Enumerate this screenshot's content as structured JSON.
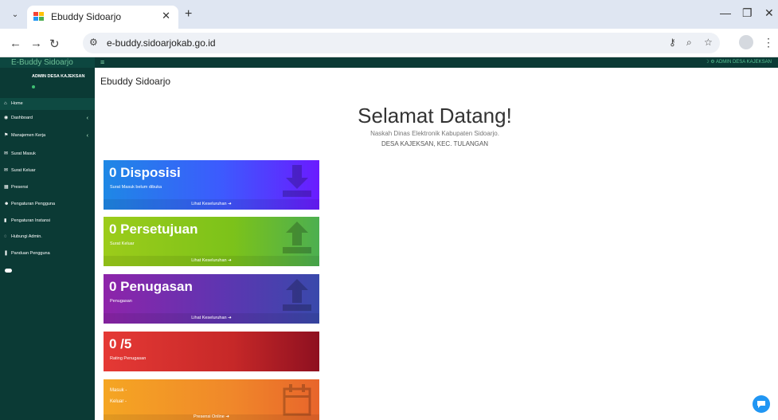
{
  "browser": {
    "tab_title": "Ebuddy Sidoarjo",
    "url": "e-buddy.sidoarjokab.go.id"
  },
  "app": {
    "brand": "E-Buddy Sidoarjo",
    "top_user": "ADMIN DESA KAJEKSAN",
    "sidebar": {
      "user_name": "ADMIN DESA KAJEKSAN",
      "items": [
        {
          "label": "Home",
          "icon": "home-icon"
        },
        {
          "label": "Dashboard",
          "icon": "dashboard-icon"
        },
        {
          "label": "Manajemen Kerja",
          "icon": "flag-icon"
        },
        {
          "label": "Surat Masuk",
          "icon": "envelope-icon"
        },
        {
          "label": "Surat Keluar",
          "icon": "envelope-icon"
        },
        {
          "label": "Presensi",
          "icon": "calendar-icon"
        },
        {
          "label": "Pengaturan Pengguna",
          "icon": "users-icon"
        },
        {
          "label": "Pengaturan Instansi",
          "icon": "building-icon"
        },
        {
          "label": "Hubungi Admin.",
          "icon": "whatsapp-icon"
        },
        {
          "label": "Panduan Pengguna",
          "icon": "book-icon"
        }
      ]
    },
    "page_title": "Ebuddy Sidoarjo",
    "welcome": {
      "title": "Selamat Datang!",
      "subtitle": "Naskah Dinas Elektronik Kabupaten Sidoarjo.",
      "location": "DESA KAJEKSAN, KEC. TULANGAN"
    },
    "cards": [
      {
        "title": "0 Disposisi",
        "sub": "Surat Masuk belum dibuka",
        "footer": "Lihat Keseluruhan"
      },
      {
        "title": "0 Persetujuan",
        "sub": "Surat Keluar",
        "footer": "Lihat Keseluruhan"
      },
      {
        "title": "0 Penugasan",
        "sub": "Penugasan",
        "footer": "Lihat Keseluruhan"
      },
      {
        "title": "0 /5",
        "sub": "Rating Penugasan"
      },
      {
        "line1": "Masuk  -",
        "line2": "Keluar  -",
        "footer": "Presensi Online"
      }
    ]
  },
  "colors": {
    "sidebar_bg": "#0b3a35",
    "accent_green": "#57c596"
  }
}
